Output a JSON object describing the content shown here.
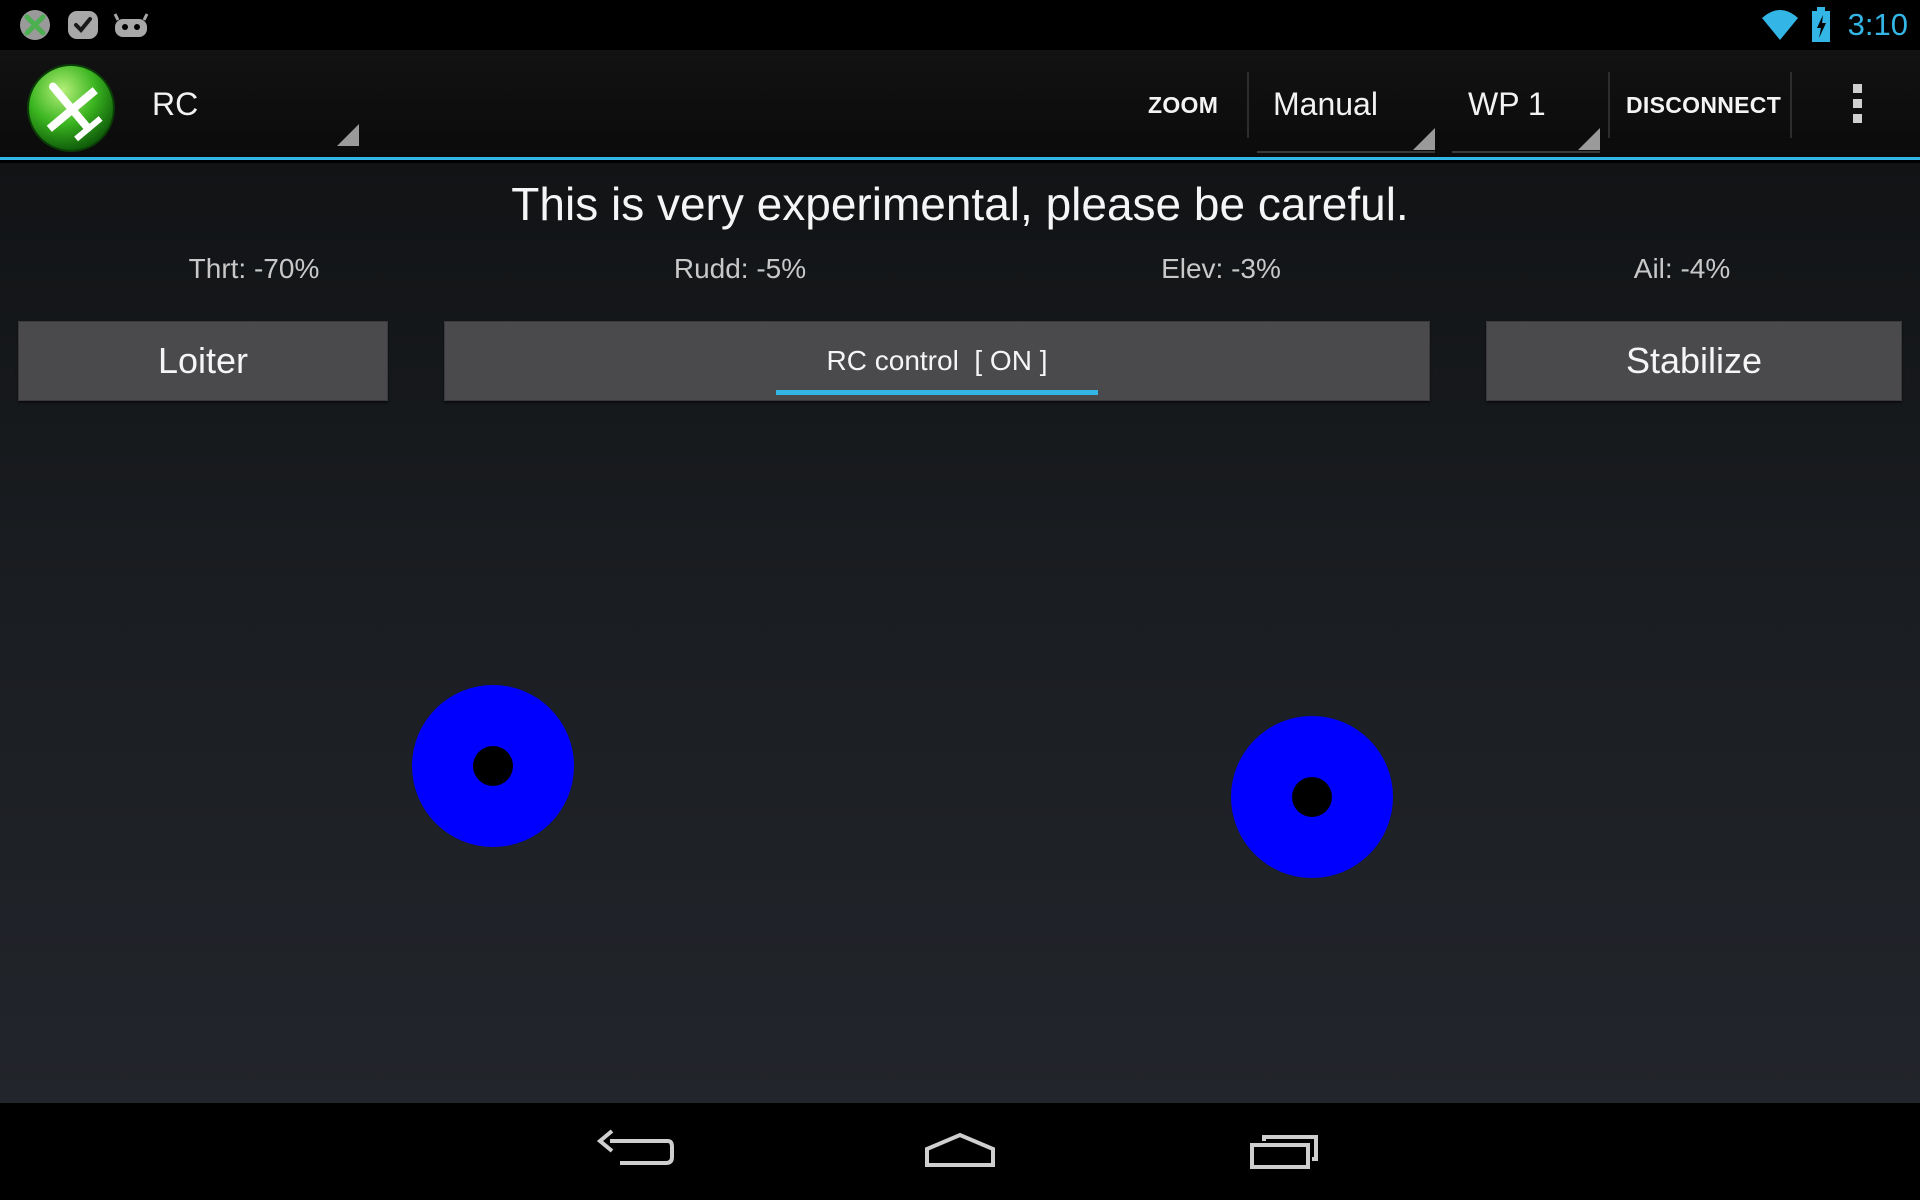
{
  "status_bar": {
    "notification_icons": [
      "xbox-icon",
      "check-icon",
      "android-icon"
    ],
    "wifi_icon": "wifi-icon",
    "battery_icon": "battery-charging-icon",
    "time": "3:10"
  },
  "action_bar": {
    "app_icon": "plane-logo-icon",
    "screen_spinner": {
      "selected": "RC"
    },
    "zoom_label": "ZOOM",
    "mode_spinner": {
      "selected": "Manual"
    },
    "waypoint_spinner": {
      "selected": "WP 1"
    },
    "disconnect_label": "DISCONNECT",
    "overflow_icon": "overflow-menu-icon"
  },
  "main": {
    "warning": "This is very experimental, please be careful.",
    "readouts": {
      "throttle": "Thrt: -70%",
      "rudder": "Rudd: -5%",
      "elevator": "Elev: -3%",
      "aileron": "Ail: -4%"
    },
    "buttons": {
      "loiter": "Loiter",
      "rc_control": "RC control  [ ON ]",
      "stabilize": "Stabilize"
    },
    "rc_control_on": true,
    "joysticks": {
      "color": "#0000ff",
      "left": {
        "name": "throttle-rudder"
      },
      "right": {
        "name": "elevator-aileron"
      }
    }
  },
  "nav_bar": {
    "buttons": [
      "back-icon",
      "home-icon",
      "recent-apps-icon"
    ]
  },
  "colors": {
    "accent": "#33b5e5",
    "joystick": "#0000ff",
    "button_bg": "#4a4a4d"
  }
}
